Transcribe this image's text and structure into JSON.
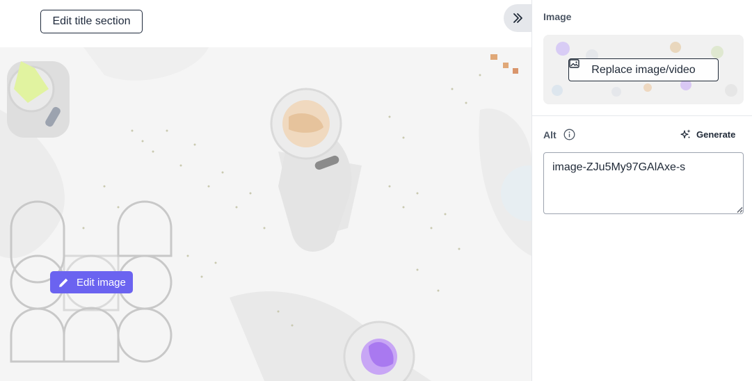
{
  "canvas": {
    "edit_title_label": "Edit title section",
    "collapse_icon": "double-chevron-right-icon",
    "edit_image_label": "Edit image",
    "edit_image_icon": "pencil-icon",
    "accent_color": "#6b63f0"
  },
  "panel": {
    "section_title": "Image",
    "replace_label": "Replace image/video",
    "replace_icon": "image-icon",
    "alt_label": "Alt",
    "info_icon": "info-icon",
    "generate_label": "Generate",
    "generate_icon": "sparkles-icon",
    "alt_value": "image-ZJu5My97GAlAxe-s"
  }
}
